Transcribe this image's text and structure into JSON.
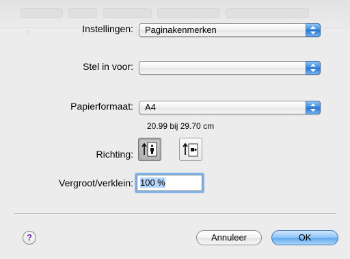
{
  "settings": {
    "label": "Instellingen:",
    "value": "Paginakenmerken"
  },
  "format_for": {
    "label": "Stel in voor:",
    "value": ""
  },
  "paper_size": {
    "label": "Papierformaat:",
    "value": "A4",
    "dimensions": "20.99 bij 29.70 cm"
  },
  "orientation": {
    "label": "Richting:",
    "options": [
      "portrait",
      "landscape"
    ],
    "selected": "portrait"
  },
  "scale": {
    "label": "Vergroot/verklein:",
    "value": "100 %"
  },
  "buttons": {
    "help": "?",
    "cancel": "Annuleer",
    "ok": "OK"
  },
  "colors": {
    "accent": "#3a86dc",
    "focus_ring": "#7fb3ea",
    "help_glyph": "#6a2a9e"
  }
}
